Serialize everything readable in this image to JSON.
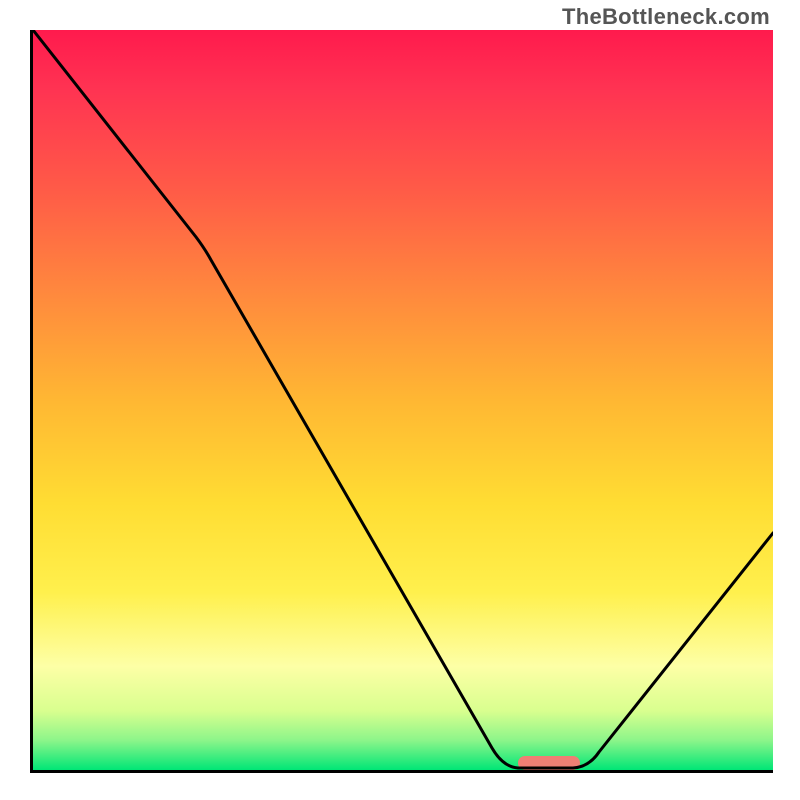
{
  "watermark": "TheBottleneck.com",
  "chart_data": {
    "type": "line",
    "title": "",
    "xlabel": "",
    "ylabel": "",
    "xlim": [
      0,
      100
    ],
    "ylim": [
      0,
      100
    ],
    "grid": false,
    "legend": false,
    "series": [
      {
        "name": "bottleneck-curve",
        "points": [
          {
            "x": 0,
            "y": 100
          },
          {
            "x": 22,
            "y": 72
          },
          {
            "x": 62,
            "y": 3
          },
          {
            "x": 65,
            "y": 0
          },
          {
            "x": 73,
            "y": 0
          },
          {
            "x": 76,
            "y": 2
          },
          {
            "x": 100,
            "y": 32
          }
        ]
      }
    ],
    "annotations": [
      {
        "name": "optimal-marker",
        "x": 70,
        "y": 0,
        "width_pct": 8,
        "color": "#ef7f74"
      }
    ],
    "gradient_stops": [
      {
        "pct": 0,
        "color": "#ff1a4d"
      },
      {
        "pct": 8,
        "color": "#ff3352"
      },
      {
        "pct": 22,
        "color": "#ff5c47"
      },
      {
        "pct": 36,
        "color": "#ff8a3d"
      },
      {
        "pct": 50,
        "color": "#ffb733"
      },
      {
        "pct": 64,
        "color": "#ffdd33"
      },
      {
        "pct": 76,
        "color": "#fff04d"
      },
      {
        "pct": 86,
        "color": "#fdffa6"
      },
      {
        "pct": 92,
        "color": "#d9ff8f"
      },
      {
        "pct": 96,
        "color": "#8cf58a"
      },
      {
        "pct": 100,
        "color": "#00e676"
      }
    ]
  }
}
